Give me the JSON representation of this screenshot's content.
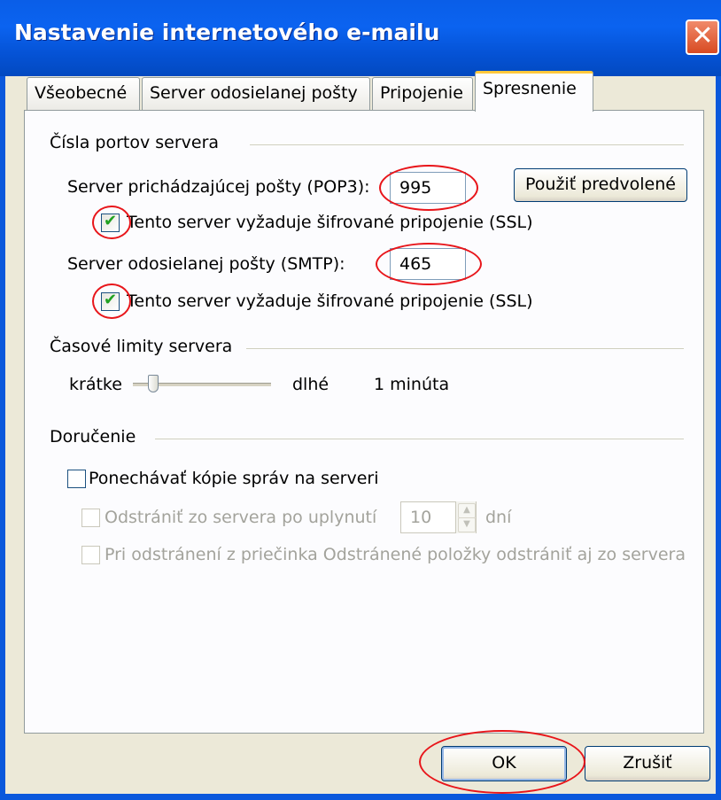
{
  "window": {
    "title": "Nastavenie internetového e-mailu",
    "close_glyph": "✕",
    "accent_color": "#0b5fe8"
  },
  "tabs": [
    {
      "label": "Všeobecné",
      "active": false
    },
    {
      "label": "Server odosielanej pošty",
      "active": false
    },
    {
      "label": "Pripojenie",
      "active": false
    },
    {
      "label": "Spresnenie",
      "active": true
    }
  ],
  "ports": {
    "group_title": "Čísla portov servera",
    "incoming_label": "Server prichádzajúcej pošty (POP3):",
    "incoming_value": "995",
    "incoming_ssl_label": "Tento server vyžaduje šifrované pripojenie (SSL)",
    "incoming_ssl_checked": true,
    "defaults_button": "Použiť predvolené",
    "outgoing_label": "Server odosielanej pošty (SMTP):",
    "outgoing_value": "465",
    "outgoing_ssl_label": "Tento server vyžaduje šifrované pripojenie (SSL)",
    "outgoing_ssl_checked": true
  },
  "timeouts": {
    "group_title": "Časové limity servera",
    "short_label": "krátke",
    "long_label": "dlhé",
    "value_text": "1 minúta",
    "slider_fraction": 0.12
  },
  "delivery": {
    "group_title": "Doručenie",
    "keep_copies_label": "Ponechávať kópie správ na serveri",
    "keep_copies_checked": false,
    "remove_after_label": "Odstrániť zo servera po uplynutí",
    "remove_after_value": "10",
    "remove_after_unit": "dní",
    "remove_deleted_label": "Pri odstránení z priečinka Odstránené položky odstrániť aj zo servera"
  },
  "buttons": {
    "ok": "OK",
    "cancel": "Zrušiť"
  },
  "highlight_color": "#e8151a"
}
